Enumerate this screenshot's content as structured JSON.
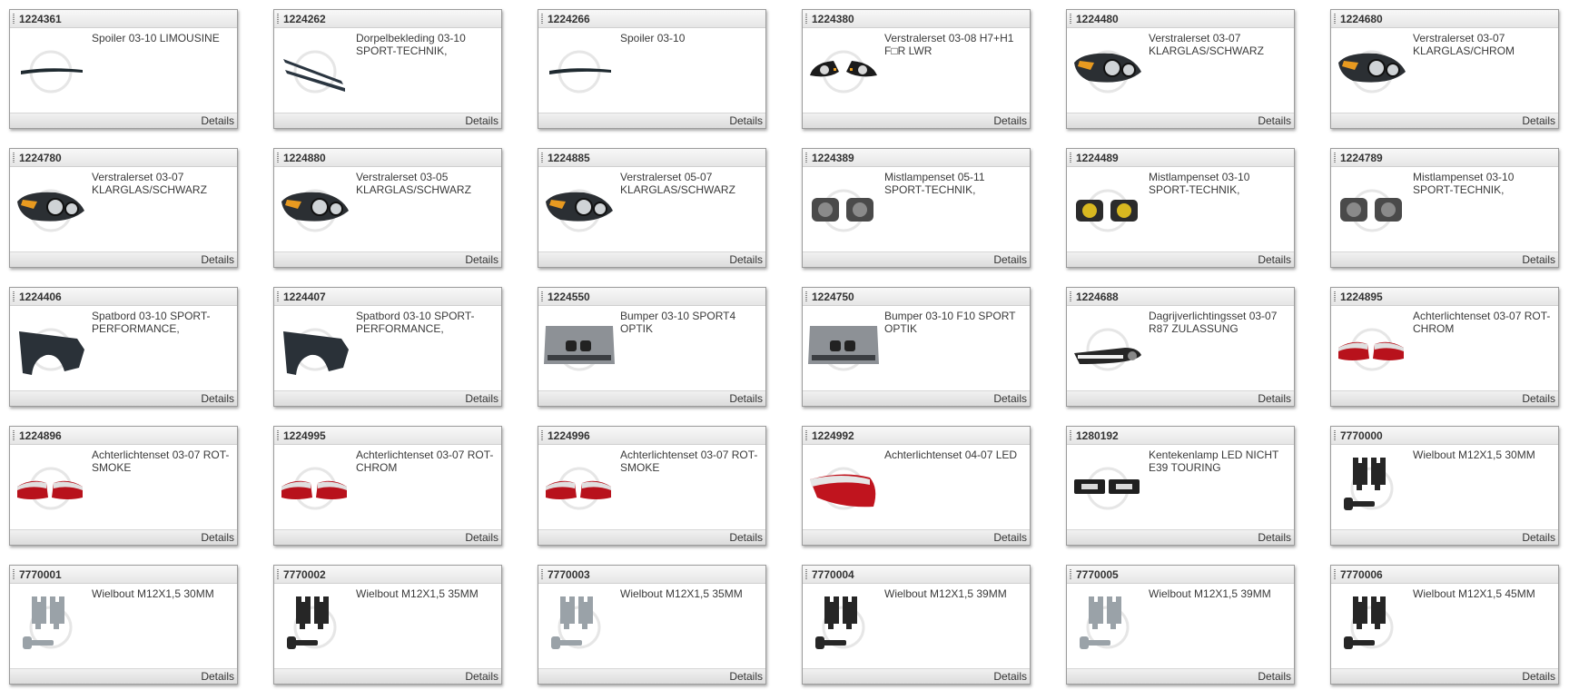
{
  "products": [
    {
      "code": "1224361",
      "title": "Spoiler 03-10 LIMOUSINE",
      "details_label": "Details",
      "icon": "spoiler-icon"
    },
    {
      "code": "1224262",
      "title": "Dorpelbekleding 03-10 SPORT-TECHNIK,",
      "details_label": "Details",
      "icon": "side-skirt-icon"
    },
    {
      "code": "1224266",
      "title": "Spoiler 03-10",
      "details_label": "Details",
      "icon": "spoiler-icon"
    },
    {
      "code": "1224380",
      "title": "Verstralerset 03-08 H7+H1 F□R LWR",
      "details_label": "Details",
      "icon": "headlight-pair-icon"
    },
    {
      "code": "1224480",
      "title": "Verstralerset 03-07 KLARGLAS/SCHWARZ",
      "details_label": "Details",
      "icon": "headlight-icon"
    },
    {
      "code": "1224680",
      "title": "Verstralerset 03-07 KLARGLAS/CHROM",
      "details_label": "Details",
      "icon": "headlight-icon"
    },
    {
      "code": "1224780",
      "title": "Verstralerset 03-07 KLARGLAS/SCHWARZ",
      "details_label": "Details",
      "icon": "headlight-icon"
    },
    {
      "code": "1224880",
      "title": "Verstralerset 03-05 KLARGLAS/SCHWARZ",
      "details_label": "Details",
      "icon": "headlight-icon"
    },
    {
      "code": "1224885",
      "title": "Verstralerset 05-07 KLARGLAS/SCHWARZ",
      "details_label": "Details",
      "icon": "headlight-icon"
    },
    {
      "code": "1224389",
      "title": "Mistlampenset 05-11 SPORT-TECHNIK,",
      "details_label": "Details",
      "icon": "foglamp-icon"
    },
    {
      "code": "1224489",
      "title": "Mistlampenset 03-10 SPORT-TECHNIK,",
      "details_label": "Details",
      "icon": "foglamp-yellow-icon"
    },
    {
      "code": "1224789",
      "title": "Mistlampenset 03-10 SPORT-TECHNIK,",
      "details_label": "Details",
      "icon": "foglamp-icon"
    },
    {
      "code": "1224406",
      "title": "Spatbord 03-10 SPORT-PERFORMANCE,",
      "details_label": "Details",
      "icon": "fender-icon"
    },
    {
      "code": "1224407",
      "title": "Spatbord 03-10 SPORT-PERFORMANCE,",
      "details_label": "Details",
      "icon": "fender-icon"
    },
    {
      "code": "1224550",
      "title": "Bumper 03-10 SPORT4 OPTIK",
      "details_label": "Details",
      "icon": "bumper-icon"
    },
    {
      "code": "1224750",
      "title": "Bumper 03-10 F10 SPORT OPTIK",
      "details_label": "Details",
      "icon": "bumper-icon"
    },
    {
      "code": "1224688",
      "title": "Dagrijverlichtingsset 03-07 R87 ZULASSUNG",
      "details_label": "Details",
      "icon": "drl-icon"
    },
    {
      "code": "1224895",
      "title": "Achterlichtenset 03-07 ROT-CHROM",
      "details_label": "Details",
      "icon": "taillight-pair-icon"
    },
    {
      "code": "1224896",
      "title": "Achterlichtenset 03-07 ROT-SMOKE",
      "details_label": "Details",
      "icon": "taillight-pair-icon"
    },
    {
      "code": "1224995",
      "title": "Achterlichtenset 03-07 ROT-CHROM",
      "details_label": "Details",
      "icon": "taillight-pair-icon"
    },
    {
      "code": "1224996",
      "title": "Achterlichtenset 03-07 ROT-SMOKE",
      "details_label": "Details",
      "icon": "taillight-pair-icon"
    },
    {
      "code": "1224992",
      "title": "Achterlichtenset 04-07 LED",
      "details_label": "Details",
      "icon": "taillight-icon"
    },
    {
      "code": "1280192",
      "title": "Kentekenlamp LED NICHT E39 TOURING",
      "details_label": "Details",
      "icon": "plate-lamp-icon"
    },
    {
      "code": "7770000",
      "title": "Wielbout M12X1,5 30MM",
      "details_label": "Details",
      "icon": "wheel-bolt-black-icon"
    },
    {
      "code": "7770001",
      "title": "Wielbout M12X1,5 30MM",
      "details_label": "Details",
      "icon": "wheel-bolt-silver-icon"
    },
    {
      "code": "7770002",
      "title": "Wielbout M12X1,5 35MM",
      "details_label": "Details",
      "icon": "wheel-bolt-black-icon"
    },
    {
      "code": "7770003",
      "title": "Wielbout M12X1,5 35MM",
      "details_label": "Details",
      "icon": "wheel-bolt-silver-icon"
    },
    {
      "code": "7770004",
      "title": "Wielbout M12X1,5 39MM",
      "details_label": "Details",
      "icon": "wheel-bolt-black-icon"
    },
    {
      "code": "7770005",
      "title": "Wielbout M12X1,5 39MM",
      "details_label": "Details",
      "icon": "wheel-bolt-silver-icon"
    },
    {
      "code": "7770006",
      "title": "Wielbout M12X1,5 45MM",
      "details_label": "Details",
      "icon": "wheel-bolt-black-icon"
    }
  ]
}
